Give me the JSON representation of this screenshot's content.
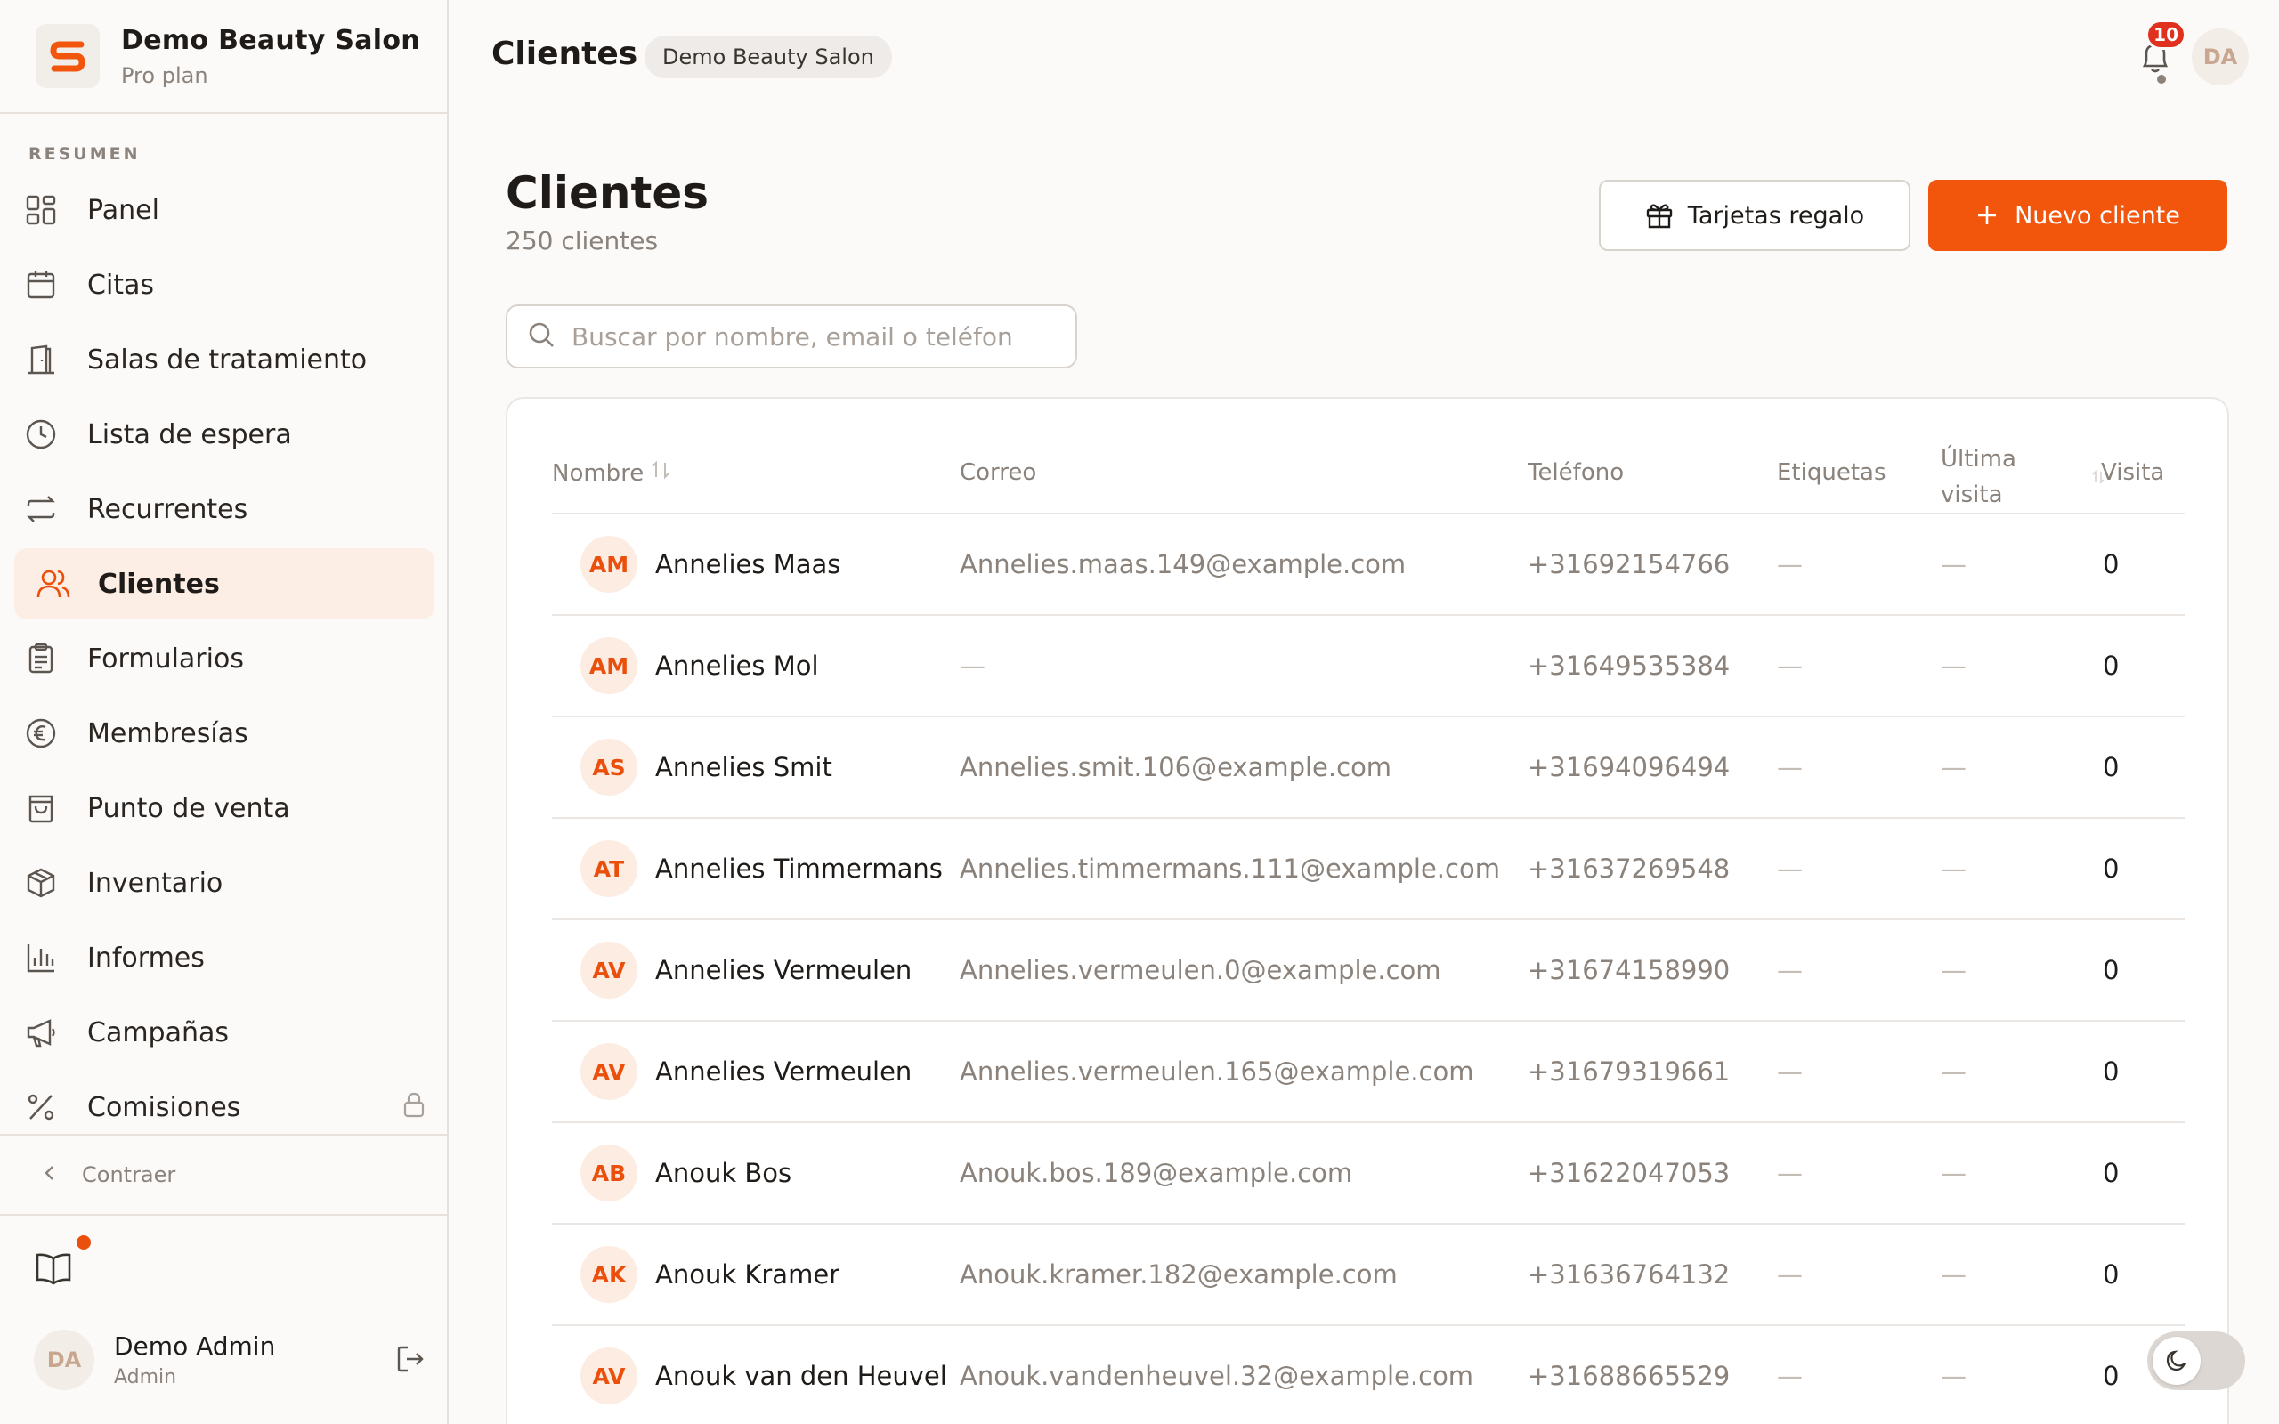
{
  "brand": {
    "name": "Demo Beauty Salon",
    "plan": "Pro plan",
    "logo_letter": "S"
  },
  "sidebar": {
    "section_label": "RESUMEN",
    "items": [
      {
        "label": "Panel",
        "icon": "grid-icon"
      },
      {
        "label": "Citas",
        "icon": "calendar-icon"
      },
      {
        "label": "Salas de tratamiento",
        "icon": "door-icon"
      },
      {
        "label": "Lista de espera",
        "icon": "clock-icon"
      },
      {
        "label": "Recurrentes",
        "icon": "repeat-icon"
      },
      {
        "label": "Clientes",
        "icon": "users-icon",
        "active": true
      },
      {
        "label": "Formularios",
        "icon": "clipboard-icon"
      },
      {
        "label": "Membresías",
        "icon": "euro-icon"
      },
      {
        "label": "Punto de venta",
        "icon": "bag-icon"
      },
      {
        "label": "Inventario",
        "icon": "box-icon"
      },
      {
        "label": "Informes",
        "icon": "bar-chart-icon"
      },
      {
        "label": "Campañas",
        "icon": "megaphone-icon"
      },
      {
        "label": "Comisiones",
        "icon": "percent-icon",
        "locked": true
      }
    ],
    "collapse_label": "Contraer"
  },
  "user": {
    "initials": "DA",
    "name": "Demo Admin",
    "role": "Admin"
  },
  "topbar": {
    "title": "Clientes",
    "salon_badge": "Demo Beauty Salon",
    "notification_count": "10",
    "avatar_initials": "DA"
  },
  "main": {
    "title": "Clientes",
    "count": "250 clientes",
    "gift_cards_label": "Tarjetas regalo",
    "new_client_label": "Nuevo cliente",
    "search_placeholder": "Buscar por nombre, email o teléfon"
  },
  "table": {
    "columns": {
      "name": "Nombre",
      "email": "Correo",
      "phone": "Teléfono",
      "tags": "Etiquetas",
      "last_visit_1": "Última",
      "last_visit_2": "visita",
      "visits": "Visita"
    },
    "rows": [
      {
        "initials": "AM",
        "name": "Annelies Maas",
        "email": "Annelies.maas.149@example.com",
        "phone": "+31692154766",
        "tags": "—",
        "last_visit": "—",
        "visits": "0"
      },
      {
        "initials": "AM",
        "name": "Annelies Mol",
        "email": "—",
        "phone": "+31649535384",
        "tags": "—",
        "last_visit": "—",
        "visits": "0"
      },
      {
        "initials": "AS",
        "name": "Annelies Smit",
        "email": "Annelies.smit.106@example.com",
        "phone": "+31694096494",
        "tags": "—",
        "last_visit": "—",
        "visits": "0"
      },
      {
        "initials": "AT",
        "name": "Annelies Timmermans",
        "email": "Annelies.timmermans.111@example.com",
        "phone": "+31637269548",
        "tags": "—",
        "last_visit": "—",
        "visits": "0"
      },
      {
        "initials": "AV",
        "name": "Annelies Vermeulen",
        "email": "Annelies.vermeulen.0@example.com",
        "phone": "+31674158990",
        "tags": "—",
        "last_visit": "—",
        "visits": "0"
      },
      {
        "initials": "AV",
        "name": "Annelies Vermeulen",
        "email": "Annelies.vermeulen.165@example.com",
        "phone": "+31679319661",
        "tags": "—",
        "last_visit": "—",
        "visits": "0"
      },
      {
        "initials": "AB",
        "name": "Anouk Bos",
        "email": "Anouk.bos.189@example.com",
        "phone": "+31622047053",
        "tags": "—",
        "last_visit": "—",
        "visits": "0"
      },
      {
        "initials": "AK",
        "name": "Anouk Kramer",
        "email": "Anouk.kramer.182@example.com",
        "phone": "+31636764132",
        "tags": "—",
        "last_visit": "—",
        "visits": "0"
      },
      {
        "initials": "AV",
        "name": "Anouk van den Heuvel",
        "email": "Anouk.vandenheuvel.32@example.com",
        "phone": "+31688665529",
        "tags": "—",
        "last_visit": "—",
        "visits": "0"
      }
    ]
  },
  "colors": {
    "accent": "#f2560d",
    "active_bg": "#fdeee5",
    "badge_red": "#e0301e"
  }
}
